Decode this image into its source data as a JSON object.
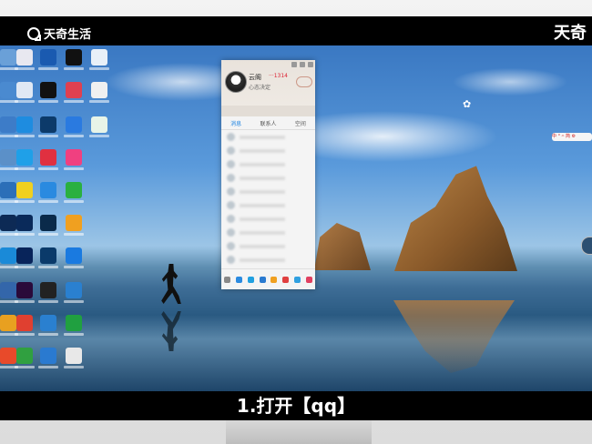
{
  "brand": {
    "left": "天奇生活",
    "right": "天奇"
  },
  "qq": {
    "name": "云阁",
    "level": "···1314",
    "signature": "心态决定",
    "tabs": [
      "消息",
      "联系人",
      "空间"
    ]
  },
  "float": {
    "pill": "中 ° 𝄐 简 ⚙"
  },
  "subtitle": "1.打开【qq】",
  "colors": {
    "accent": "#1a82e2",
    "bar": "#000000"
  }
}
